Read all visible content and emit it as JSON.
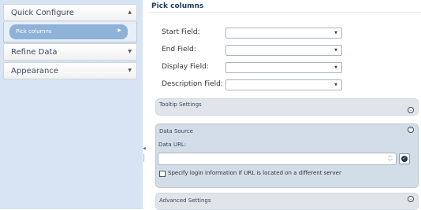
{
  "sidebar": {
    "sections": [
      {
        "label": "Quick Configure",
        "arrow": "▲"
      },
      {
        "label": "Refine Data",
        "arrow": "▼"
      },
      {
        "label": "Appearance",
        "arrow": "▼"
      }
    ],
    "selected_item": {
      "label": "Pick columns",
      "arrow": "▶"
    }
  },
  "main": {
    "title": "Pick columns",
    "fields": [
      {
        "label": "Start Field:",
        "value": ""
      },
      {
        "label": "End Field:",
        "value": ""
      },
      {
        "label": "Display Field:",
        "value": ""
      },
      {
        "label": "Description Field:",
        "value": ""
      }
    ],
    "tooltip_settings": {
      "title": "Tooltip Settings"
    },
    "data_source": {
      "title": "Data Source",
      "url_label": "Data URL:",
      "url_value": "",
      "login_checkbox_label": "Specify login information if URL is located on a different server",
      "login_checked": false
    },
    "advanced_settings": {
      "title": "Advanced Settings"
    }
  },
  "icons": {
    "collapse": "chevron-circle-up-icon",
    "expand": "chevron-circle-down-icon",
    "confirm": "check-icon"
  },
  "colors": {
    "sidebar_bg": "#d6e4f3",
    "selected_item_bg": "#8fb2d8",
    "title_color": "#1f3a5a",
    "confirm_button": "#1c3556"
  }
}
